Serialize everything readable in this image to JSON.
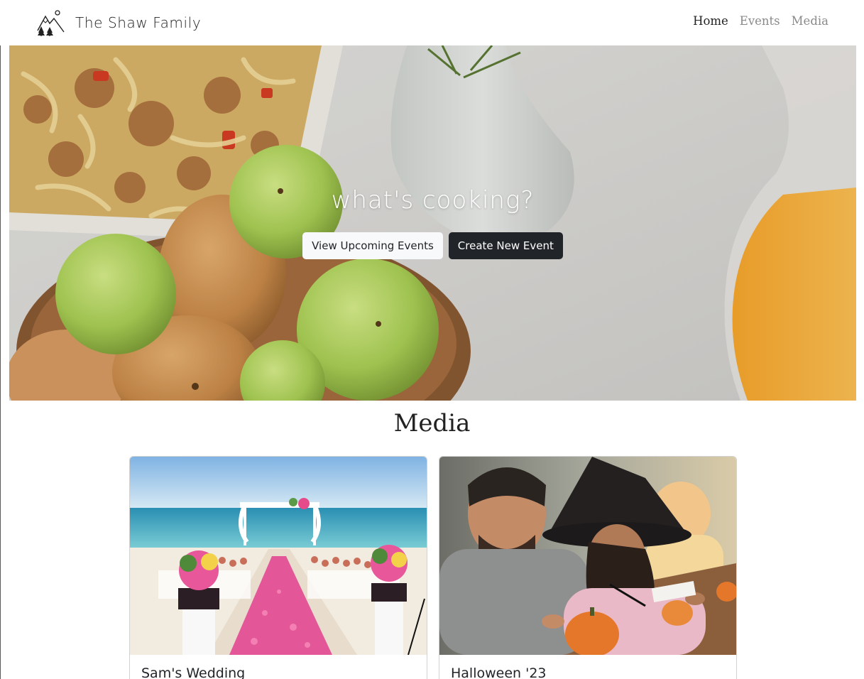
{
  "brand": {
    "name": "The Shaw Family",
    "logo_icon": "mountain-trees-icon"
  },
  "nav": {
    "items": [
      {
        "label": "Home",
        "active": true
      },
      {
        "label": "Events",
        "active": false
      },
      {
        "label": "Media",
        "active": false
      }
    ]
  },
  "hero": {
    "title": "what's cooking?",
    "image": "food-table-photo",
    "buttons": {
      "view_label": "View Upcoming Events",
      "create_label": "Create New Event"
    }
  },
  "media": {
    "heading": "Media",
    "cards": [
      {
        "title": "Sam's Wedding",
        "image": "beach-wedding-photo"
      },
      {
        "title": "Halloween '23",
        "image": "pumpkin-carving-photo"
      }
    ]
  },
  "colors": {
    "dark_button": "#212529",
    "light_button": "#f8f9fa",
    "nav_inactive": "#8a8a8a"
  }
}
